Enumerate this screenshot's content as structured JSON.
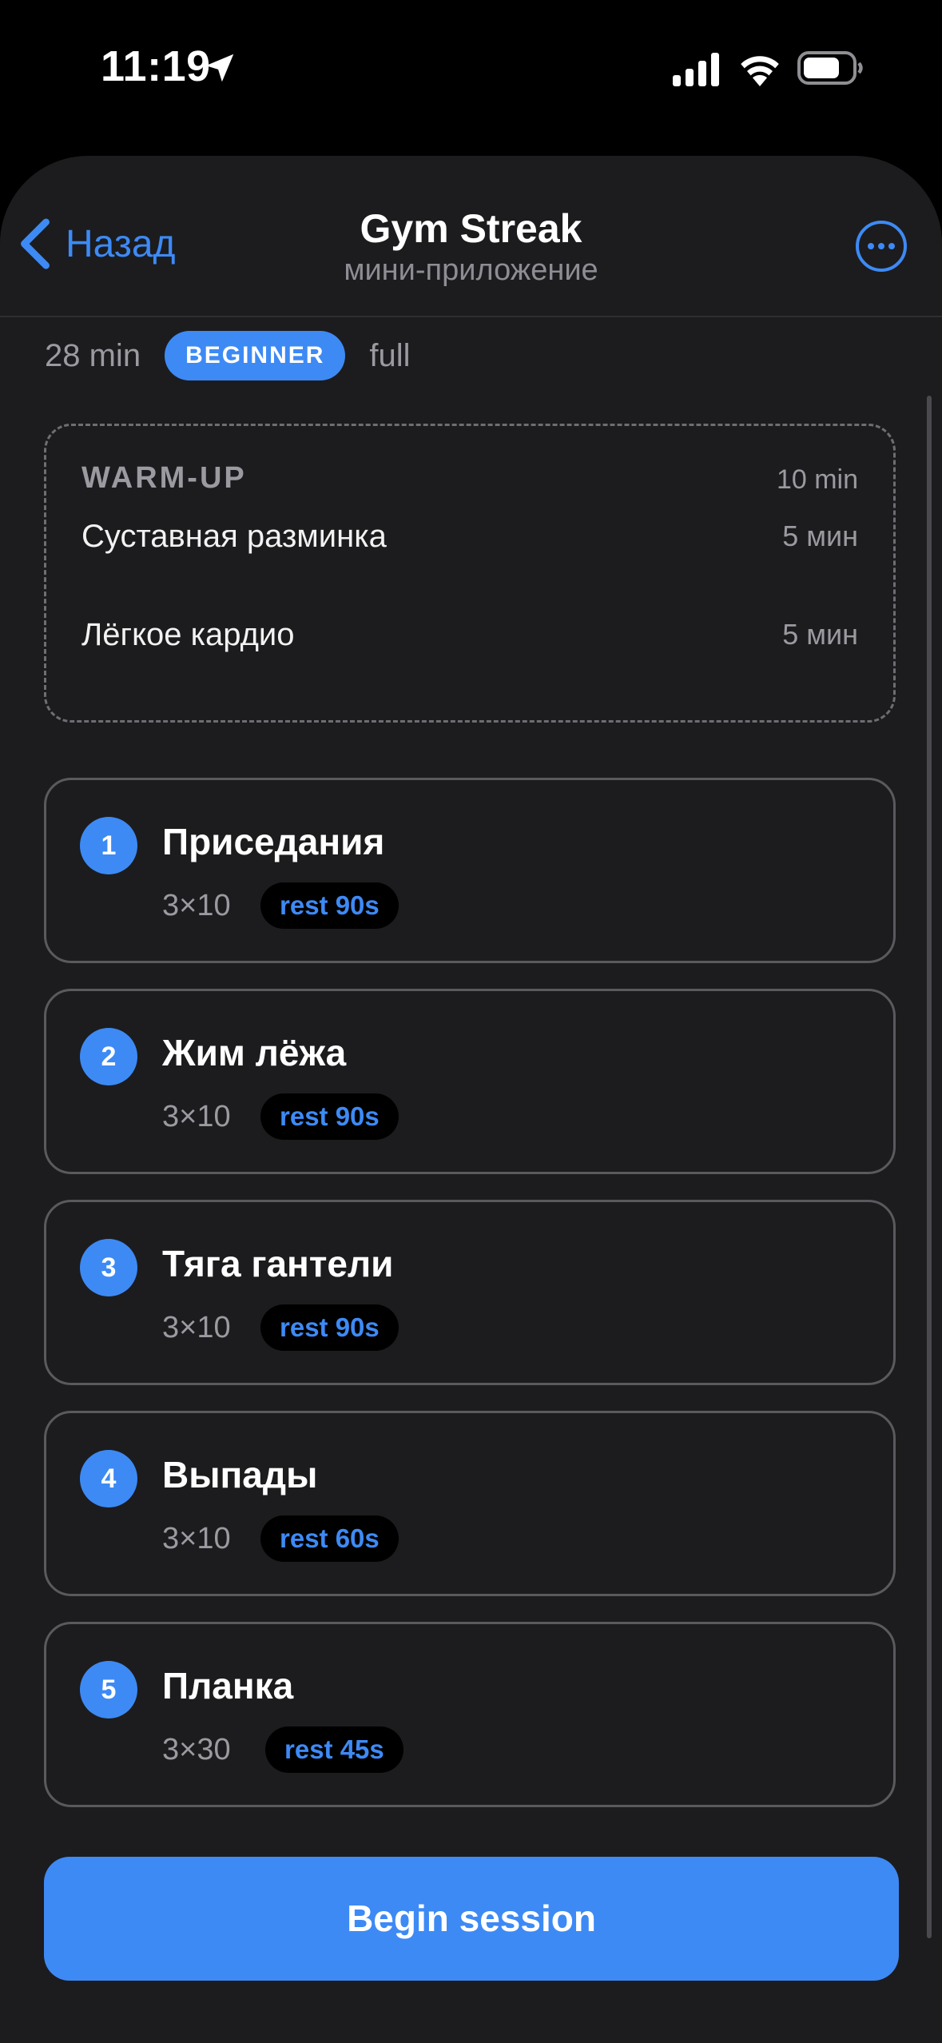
{
  "status_bar": {
    "time": "11:19"
  },
  "nav": {
    "back_label": "Назад",
    "title": "Gym Streak",
    "subtitle": "мини-приложение"
  },
  "workout": {
    "duration": "28 min",
    "level": "BEGINNER",
    "type": "full"
  },
  "warmup": {
    "title": "WARM-UP",
    "total": "10 min",
    "items": [
      {
        "name": "Суставная разминка",
        "duration": "5 мин"
      },
      {
        "name": "Лёгкое кардио",
        "duration": "5 мин"
      }
    ]
  },
  "exercises": [
    {
      "number": "1",
      "name": "Приседания",
      "scheme": "3×10",
      "rest": "rest 90s"
    },
    {
      "number": "2",
      "name": "Жим лёжа",
      "scheme": "3×10",
      "rest": "rest 90s"
    },
    {
      "number": "3",
      "name": "Тяга гантели",
      "scheme": "3×10",
      "rest": "rest 90s"
    },
    {
      "number": "4",
      "name": "Выпады",
      "scheme": "3×10",
      "rest": "rest 60s"
    },
    {
      "number": "5",
      "name": "Планка",
      "scheme": "3×30",
      "rest": "rest 45s"
    }
  ],
  "cta": {
    "label": "Begin session"
  },
  "colors": {
    "accent": "#3d8af5",
    "background": "#1c1c1e",
    "text_secondary": "#9a9aa0"
  },
  "icons": [
    "location-arrow-icon",
    "cellular-signal-icon",
    "wifi-icon",
    "battery-icon",
    "chevron-left-icon",
    "more-icon"
  ]
}
